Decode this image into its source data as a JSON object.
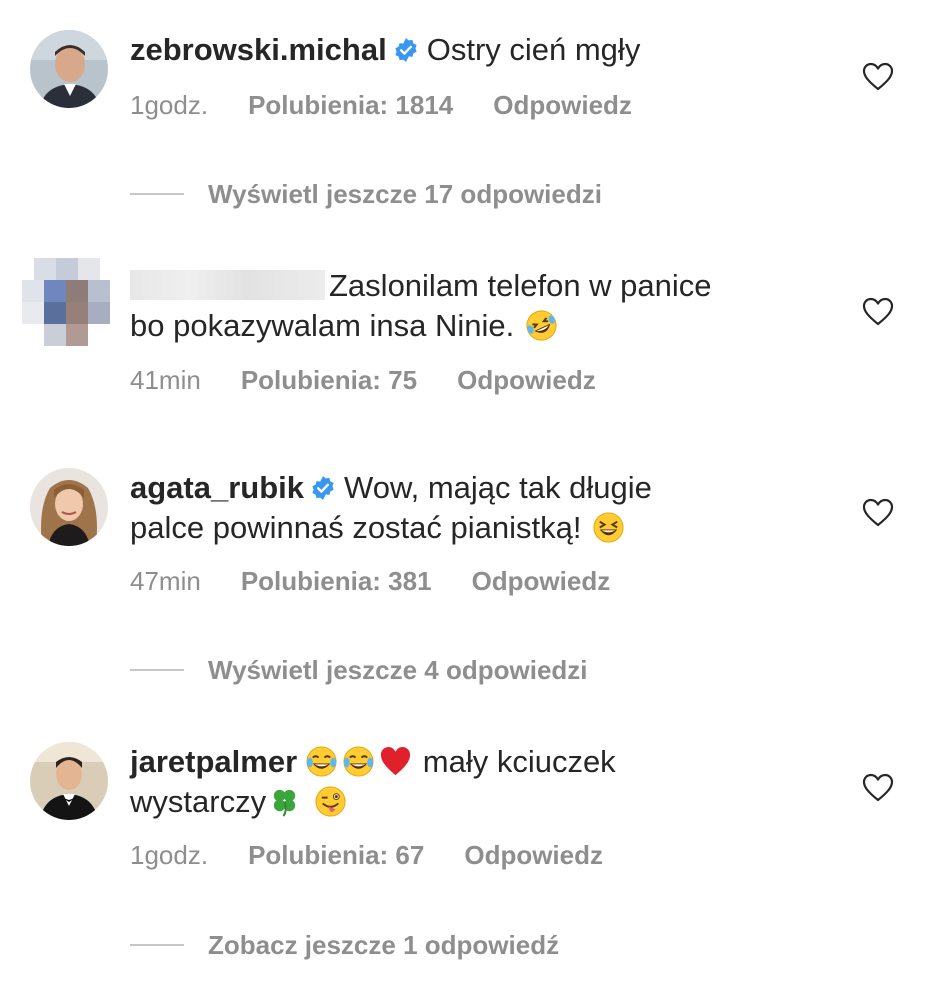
{
  "comments": [
    {
      "username": "zebrowski.michal",
      "verified": true,
      "text": "Ostry cień mgły",
      "time": "1godz.",
      "likes": "Polubienia: 1814",
      "reply": "Odpowiedz",
      "view_more": "Wyświetl jeszcze 17 odpowiedzi"
    },
    {
      "username": "",
      "verified": false,
      "text_line1": "Zaslonilam telefon w panice",
      "text_line2": "bo  pokazywalam insa Ninie.",
      "emoji": "rolling-on-floor-laughing-emoji",
      "time": "41min",
      "likes": "Polubienia: 75",
      "reply": "Odpowiedz"
    },
    {
      "username": "agata_rubik",
      "verified": true,
      "text_line1": "Wow, mając tak długie",
      "text_line2": "palce powinnaś zostać pianistką!",
      "emoji": "grinning-squinting-emoji",
      "time": "47min",
      "likes": "Polubienia: 381",
      "reply": "Odpowiedz",
      "view_more": "Wyświetl jeszcze 4 odpowiedzi"
    },
    {
      "username": "jaretpalmer",
      "verified": false,
      "emojis": [
        "tears-of-joy-emoji",
        "tears-of-joy-emoji",
        "red-heart-emoji",
        "four-leaf-clover-emoji",
        "winking-tongue-emoji"
      ],
      "text_part1": " mały kciuczek",
      "text_part2": "wystarczy",
      "time": "1godz.",
      "likes": "Polubienia: 67",
      "reply": "Odpowiedz",
      "view_more": "Zobacz jeszcze 1 odpowiedź"
    }
  ],
  "colors": {
    "text": "#262626",
    "meta": "#8e8e8e",
    "verified": "#3897f0",
    "divider": "#c7c7c7"
  }
}
